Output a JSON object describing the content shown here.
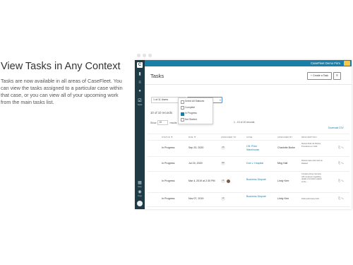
{
  "hero": {
    "title": "View Tasks in Any Context",
    "body": "Tasks are now available in all areas of CaseFleet. You can view the tasks assigned to a particular case within that case, or you can view all of your upcoming work from the main tasks list."
  },
  "topbar": {
    "crumb": "CaseFleet Demo Firm"
  },
  "rail": {
    "logo": "C",
    "items": [
      {
        "icon": "▮",
        "label": ""
      },
      {
        "icon": "≡",
        "label": ""
      },
      {
        "icon": "●",
        "label": ""
      },
      {
        "icon": "☑",
        "label": "Tasks"
      }
    ],
    "bottom_items": [
      {
        "icon": "▦",
        "label": "Help"
      },
      {
        "icon": "◉",
        "label": "Orgs"
      }
    ]
  },
  "page": {
    "title": "Tasks",
    "create_label": "+ Create a Task",
    "menu_icon": "≡"
  },
  "filters": {
    "assignee": "1 of 11 Users",
    "status": "1 of 3 Statuses"
  },
  "status_options": [
    {
      "label": "Select All Statuses",
      "checked": false
    },
    {
      "label": "Complete",
      "checked": false
    },
    {
      "label": "In Progress",
      "checked": true
    },
    {
      "label": "Not Started",
      "checked": false
    }
  ],
  "records": {
    "count": "10 of 10 records",
    "show_label": "Show",
    "show_value": "10",
    "results_label": "results",
    "range": "1 - 10 of 10 records",
    "download": "Download CSV"
  },
  "table": {
    "headers": [
      "STATUS ▼",
      "DUE ▼",
      "ASSIGNED TO",
      "CASE",
      "ASSIGNED BY",
      "DESCRIPTION"
    ],
    "rows": [
      {
        "status": "In Progress",
        "due": "Sep 20, 2020",
        "assigned": "CB",
        "case": "CB: Price Warehouse",
        "by": "Charlotte Burke",
        "desc": "Review Rule 4a Partner Procedures in CHD"
      },
      {
        "status": "In Progress",
        "due": "Jul 15, 2020",
        "assigned": "MR",
        "case": "Doe v. Hospital",
        "by": "Meg Hall",
        "desc": "Review case and mark as Related"
      },
      {
        "status": "In Progress",
        "due": "Mar 4, 2019 at 2:30 PM",
        "assigned": "LR",
        "case": "Business Dispute",
        "by": "Lindy Kerr",
        "desc": "Contact phone interview with employer regarding details of incident related to the ..."
      },
      {
        "status": "In Progress",
        "due": "Nov 07, 2019",
        "assigned": "LR",
        "case": "Business Dispute",
        "by": "Lindy Kerr",
        "desc": "Draft preliminary brief"
      }
    ]
  },
  "colors": {
    "accent": "#1a7fa8",
    "rail": "#1e3a45"
  }
}
